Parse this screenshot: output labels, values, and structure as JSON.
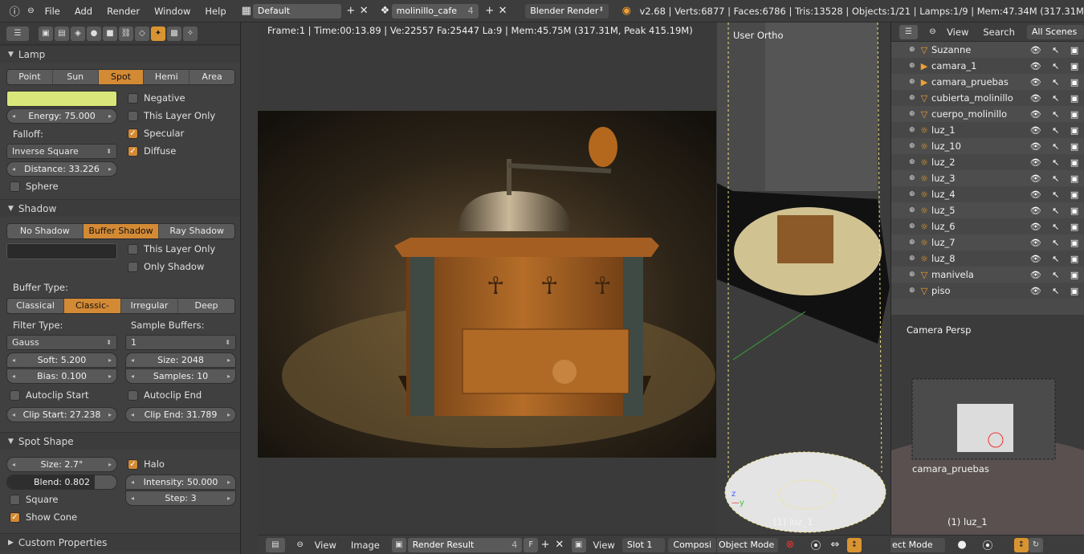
{
  "topbar": {
    "menus": [
      "File",
      "Add",
      "Render",
      "Window",
      "Help"
    ],
    "screen_layout": "Default",
    "scene": "molinillo_cafe",
    "scene_users": "4",
    "engine": "Blender Render",
    "stats": "v2.68 | Verts:6877 | Faces:6786 | Tris:13528 | Objects:1/21 | Lamps:1/9 | Mem:47.34M (317.31M"
  },
  "lamp": {
    "title": "Lamp",
    "types": [
      "Point",
      "Sun",
      "Spot",
      "Hemi",
      "Area"
    ],
    "active_type": "Spot",
    "color": "#d9e77a",
    "energy": "Energy: 75.000",
    "falloff_label": "Falloff:",
    "falloff_value": "Inverse Square",
    "distance": "Distance: 33.226",
    "sphere": "Sphere",
    "negative": "Negative",
    "this_layer_only": "This Layer Only",
    "specular": "Specular",
    "diffuse": "Diffuse"
  },
  "shadow": {
    "title": "Shadow",
    "modes": [
      "No Shadow",
      "Buffer Shadow",
      "Ray Shadow"
    ],
    "active_mode": "Buffer Shadow",
    "this_layer_only": "This Layer Only",
    "only_shadow": "Only Shadow",
    "buffer_type_label": "Buffer Type:",
    "buffer_types": [
      "Classical",
      "Classic-Halfw",
      "Irregular",
      "Deep"
    ],
    "active_buffer_type": "Classic-Halfw",
    "filter_type_label": "Filter Type:",
    "filter_type": "Gauss",
    "sample_buffers_label": "Sample Buffers:",
    "sample_buffers": "1",
    "soft": "Soft: 5.200",
    "size": "Size: 2048",
    "bias": "Bias: 0.100",
    "samples": "Samples: 10",
    "autoclip_start": "Autoclip Start",
    "autoclip_end": "Autoclip End",
    "clip_start": "Clip Start: 27.238",
    "clip_end": "Clip End: 31.789"
  },
  "spot_shape": {
    "title": "Spot Shape",
    "size": "Size: 2.7°",
    "blend": "Blend: 0.802",
    "blend_fraction": 0.802,
    "halo": "Halo",
    "intensity": "Intensity: 50.000",
    "step": "Step: 3",
    "square": "Square",
    "show_cone": "Show Cone"
  },
  "custom_properties": "Custom Properties",
  "render_view": {
    "info": "Frame:1 | Time:00:13.89 | Ve:22557 Fa:25447 La:9 | Mem:45.75M (317.31M, Peak 415.19M)",
    "header": {
      "view": "View",
      "image": "Image",
      "image_name": "Render Result",
      "users": "4",
      "fake": "F",
      "view2": "View",
      "slot": "Slot 1",
      "composite": "Composi"
    }
  },
  "ortho_view": {
    "label": "User Ortho",
    "object": "(1) luz_1",
    "mode": "Object Mode"
  },
  "outliner": {
    "view": "View",
    "search": "Search",
    "filter": "All Scenes",
    "items": [
      {
        "name": "Suzanne",
        "icon": "mesh-icon"
      },
      {
        "name": "camara_1",
        "icon": "camera-icon"
      },
      {
        "name": "camara_pruebas",
        "icon": "camera-icon"
      },
      {
        "name": "cubierta_molinillo",
        "icon": "mesh-icon"
      },
      {
        "name": "cuerpo_molinillo",
        "icon": "mesh-icon"
      },
      {
        "name": "luz_1",
        "icon": "lamp-icon"
      },
      {
        "name": "luz_10",
        "icon": "lamp-icon"
      },
      {
        "name": "luz_2",
        "icon": "lamp-icon"
      },
      {
        "name": "luz_3",
        "icon": "lamp-icon"
      },
      {
        "name": "luz_4",
        "icon": "lamp-icon"
      },
      {
        "name": "luz_5",
        "icon": "lamp-icon"
      },
      {
        "name": "luz_6",
        "icon": "lamp-icon"
      },
      {
        "name": "luz_7",
        "icon": "lamp-icon"
      },
      {
        "name": "luz_8",
        "icon": "lamp-icon"
      },
      {
        "name": "manivela",
        "icon": "mesh-icon"
      },
      {
        "name": "piso",
        "icon": "mesh-icon"
      }
    ]
  },
  "camera_view": {
    "label": "Camera Persp",
    "camera_name": "camara_pruebas",
    "object": "(1) luz_1",
    "mode": "ect Mode"
  }
}
